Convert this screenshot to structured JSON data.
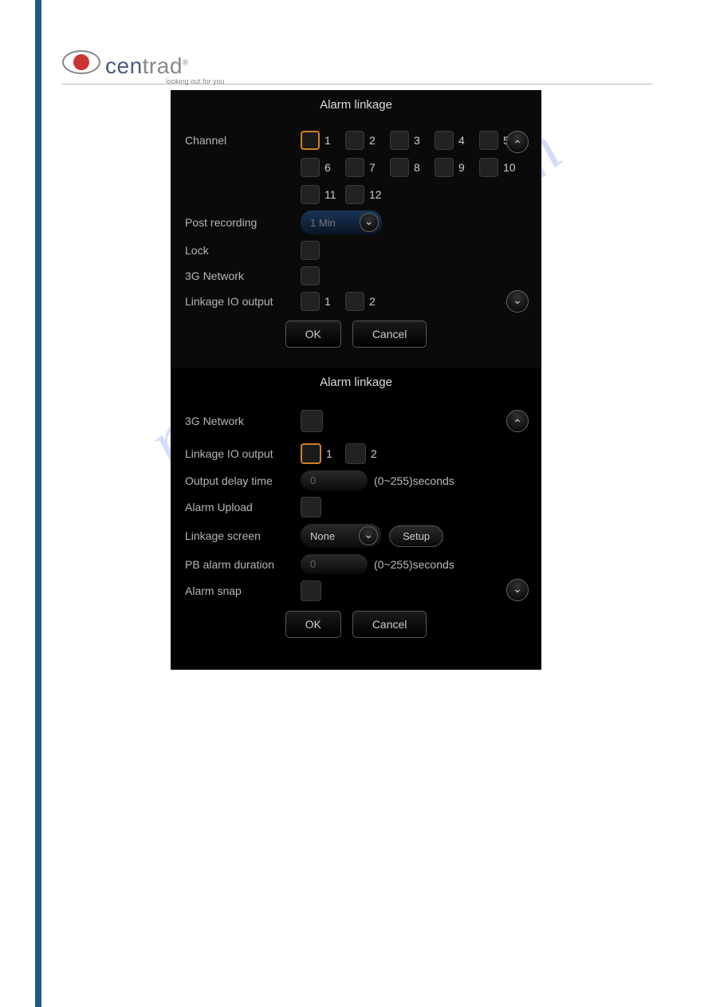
{
  "logo": {
    "name": "centrad",
    "tagline": "looking out for you"
  },
  "watermark": "manualshive.com",
  "dialog1": {
    "title": "Alarm linkage",
    "channel_label": "Channel",
    "channels": [
      "1",
      "2",
      "3",
      "4",
      "5",
      "6",
      "7",
      "8",
      "9",
      "10",
      "11",
      "12"
    ],
    "channel_selected": 1,
    "post_recording_label": "Post recording",
    "post_recording_value": "1 Min",
    "lock_label": "Lock",
    "g3_label": "3G Network",
    "linkage_io_label": "Linkage IO output",
    "linkage_io": [
      "1",
      "2"
    ],
    "ok": "OK",
    "cancel": "Cancel"
  },
  "dialog2": {
    "title": "Alarm linkage",
    "g3_label": "3G Network",
    "linkage_io_label": "Linkage IO output",
    "linkage_io": [
      "1",
      "2"
    ],
    "linkage_io_selected": 1,
    "output_delay_label": "Output delay time",
    "output_delay_value": "0",
    "output_delay_hint": "(0~255)seconds",
    "alarm_upload_label": "Alarm Upload",
    "linkage_screen_label": "Linkage screen",
    "linkage_screen_value": "None",
    "setup": "Setup",
    "pb_alarm_label": "PB alarm duration",
    "pb_alarm_value": "0",
    "pb_alarm_hint": "(0~255)seconds",
    "alarm_snap_label": "Alarm snap",
    "ok": "OK",
    "cancel": "Cancel"
  }
}
